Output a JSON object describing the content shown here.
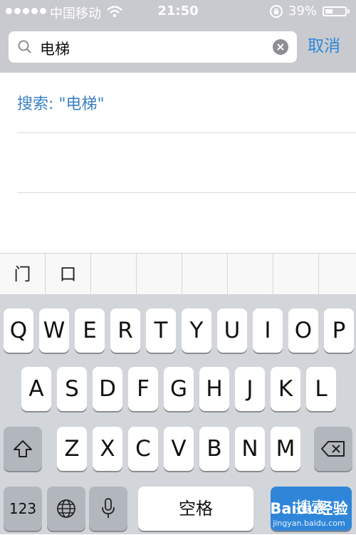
{
  "status_bar": {
    "carrier": "中国移动",
    "time": "21:50",
    "battery_percent": "39%",
    "battery_level": 0.39
  },
  "search": {
    "query": "电梯",
    "cancel_label": "取消"
  },
  "results": {
    "items": [
      "搜索: \"电梯\""
    ]
  },
  "candidates": [
    "门",
    "口"
  ],
  "keyboard": {
    "row1": [
      "Q",
      "W",
      "E",
      "R",
      "T",
      "Y",
      "U",
      "I",
      "O",
      "P"
    ],
    "row2": [
      "A",
      "S",
      "D",
      "F",
      "G",
      "H",
      "J",
      "K",
      "L"
    ],
    "row3": [
      "Z",
      "X",
      "C",
      "V",
      "B",
      "N",
      "M"
    ],
    "numbers_label": "123",
    "space_label": "空格",
    "return_label": "搜索"
  },
  "watermark": {
    "logo": "Baidu经验",
    "url": "jingyan.baidu.com"
  },
  "colors": {
    "accent": "#2f86d9",
    "status_bar_bg": "#c9cacf",
    "keyboard_bg": "#d2d5da"
  }
}
